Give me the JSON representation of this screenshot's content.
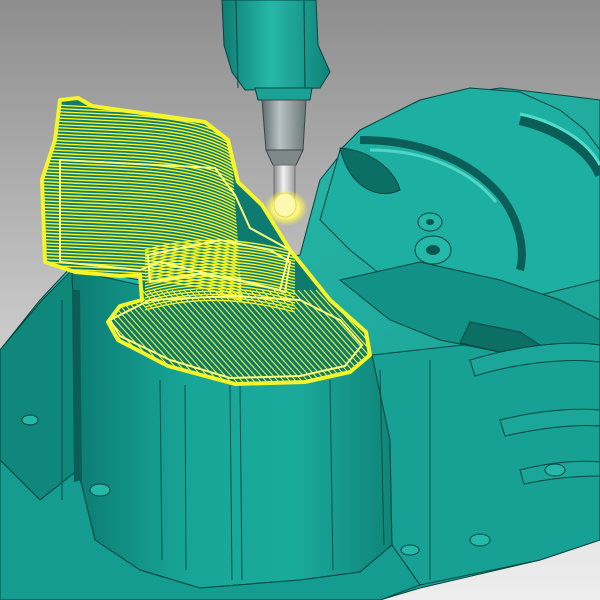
{
  "viewport": {
    "label": "",
    "background_top": "#8d8d8d",
    "background_bottom": "#eeeeee"
  },
  "part": {
    "icon": "cast-housing-model",
    "color_light": "#2fbfb0",
    "color_mid": "#139c8f",
    "color_dark": "#0b6e66",
    "edge_color": "#06443f"
  },
  "toolpath": {
    "icon": "toolpath-icon",
    "color": "#f4f52a",
    "highlight": "#fdfd7a"
  },
  "tool": {
    "icon": "milling-tool-icon",
    "spindle_color": "#1aa193",
    "holder_color": "#8f9a9c",
    "cutter_color": "#d6d6d6",
    "tip_glow": "#fbf6a8"
  }
}
